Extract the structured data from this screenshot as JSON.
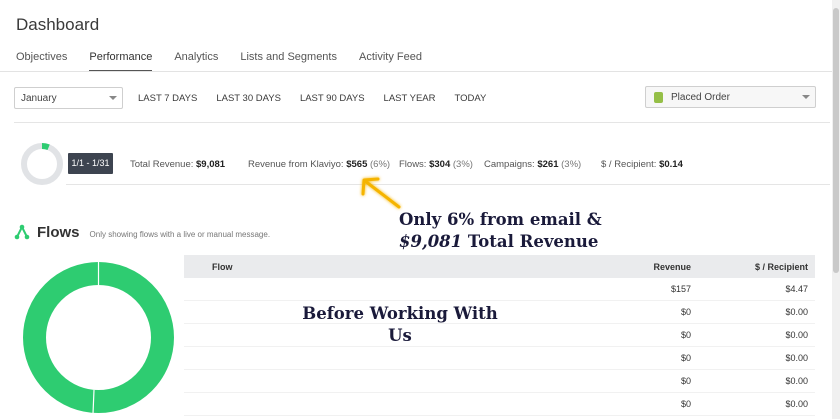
{
  "page": {
    "title": "Dashboard"
  },
  "tabs": [
    {
      "label": "Objectives",
      "active": false
    },
    {
      "label": "Performance",
      "active": true
    },
    {
      "label": "Analytics",
      "active": false
    },
    {
      "label": "Lists and Segments",
      "active": false
    },
    {
      "label": "Activity Feed",
      "active": false
    }
  ],
  "filters": {
    "month": "January",
    "ranges": [
      "LAST 7 DAYS",
      "LAST 30 DAYS",
      "LAST 90 DAYS",
      "LAST YEAR",
      "TODAY"
    ],
    "metric": "Placed Order",
    "metric_icon": "shopify-bag-icon"
  },
  "summary": {
    "date_range": "1/1 - 1/31",
    "total_revenue_label": "Total Revenue:",
    "total_revenue_value": "$9,081",
    "klaviyo_label": "Revenue from Klaviyo:",
    "klaviyo_value": "$565",
    "klaviyo_pct": "(6%)",
    "flows_label": "Flows:",
    "flows_value": "$304",
    "flows_pct": "(3%)",
    "campaigns_label": "Campaigns:",
    "campaigns_value": "$261",
    "campaigns_pct": "(3%)",
    "per_recipient_label": "$ / Recipient:",
    "per_recipient_value": "$0.14",
    "donut_share": 0.06
  },
  "flows": {
    "title": "Flows",
    "note": "Only showing flows with a live or manual message.",
    "table": {
      "headers": {
        "flow": "Flow",
        "revenue": "Revenue",
        "per_recipient": "$ / Recipient"
      },
      "rows": [
        {
          "revenue": "$157",
          "per_recipient": "$4.47"
        },
        {
          "revenue": "$0",
          "per_recipient": "$0.00"
        },
        {
          "revenue": "$0",
          "per_recipient": "$0.00"
        },
        {
          "revenue": "$0",
          "per_recipient": "$0.00"
        },
        {
          "revenue": "$0",
          "per_recipient": "$0.00"
        },
        {
          "revenue": "$0",
          "per_recipient": "$0.00"
        }
      ]
    }
  },
  "annotations": {
    "callout_line1": "Only 6% from email &",
    "callout_amount": "$9,081",
    "callout_rest": "Total Revenue",
    "before_text": "Before Working With Us"
  },
  "colors": {
    "accent_green": "#2ecc71",
    "chip_bg": "#3d4450",
    "arrow": "#f5b400"
  }
}
